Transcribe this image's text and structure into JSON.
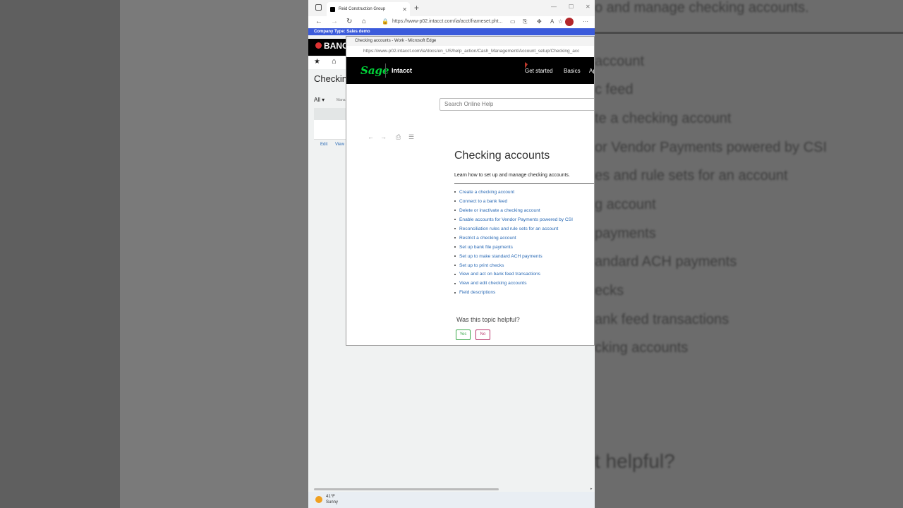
{
  "browser": {
    "tab_title": "Reid Construction Group",
    "url": "https://www-p02.intacct.com/ia/acct/frameset.pht...",
    "company_bar": "Company Type: Sales demo"
  },
  "app": {
    "logo": "BANC",
    "page_title": "Checkin",
    "filter": "All ▾",
    "manage": "Mana",
    "edit_link": "Edit",
    "view_link": "View"
  },
  "taskbar": {
    "temperature": "41°F",
    "condition": "Sunny"
  },
  "help_window": {
    "title": "Checking accounts - Work - Microsoft Edge",
    "url": "https://www-p02.intacct.com/ia/docs/en_US/help_action/Cash_Management/Account_setup/Checking_acc",
    "brand": "Sage",
    "product": "Intacct",
    "nav": [
      "Get started",
      "Basics",
      "Ap"
    ],
    "search_placeholder": "Search Online Help",
    "heading": "Checking accounts",
    "lead": "Learn how to set up and manage checking accounts.",
    "links": [
      "Create a checking account",
      "Connect to a bank feed",
      "Delete or inactivate a checking account",
      "Enable accounts for Vendor Payments powered by CSI",
      "Reconciliation rules and rule sets for an account",
      "Restrict a checking account",
      "Set up bank file payments",
      "Set up to make standard ACH payments",
      "Set up to print checks",
      "View and act on bank feed transactions",
      "View and edit checking accounts",
      "Field descriptions"
    ],
    "helpful_question": "Was this topic helpful?",
    "yes_label": "Yes",
    "no_label": "No"
  },
  "background_right": {
    "lines": [
      "o and manage checking accounts.",
      "account",
      "c feed",
      "te a checking account",
      "or Vendor Payments powered by CSI",
      "es and rule sets for an account",
      "g account",
      "payments",
      "andard ACH payments",
      "ecks",
      "ank feed transactions",
      "cking accounts",
      "t helpful?"
    ]
  }
}
